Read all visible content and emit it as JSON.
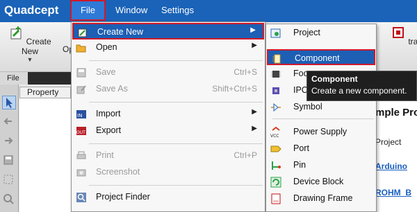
{
  "app": {
    "name": "Quadcept"
  },
  "menubar": {
    "file": "File",
    "window": "Window",
    "settings": "Settings"
  },
  "ribbon": {
    "create_new": "Create New",
    "open_partial": "Op",
    "extra_partial": "tra Librari",
    "tab_file": "File"
  },
  "panel": {
    "property_header": "Property"
  },
  "background": {
    "title_partial": "mple Pro",
    "project_label": "Project",
    "link1": "Arduino",
    "link2": "ROHM_B"
  },
  "file_menu": {
    "create_new": "Create New",
    "open": "Open",
    "save": "Save",
    "save_shortcut": "Ctrl+S",
    "save_as": "Save As",
    "save_as_shortcut": "Shift+Ctrl+S",
    "import": "Import",
    "export": "Export",
    "print": "Print",
    "print_shortcut": "Ctrl+P",
    "screenshot": "Screenshot",
    "project_finder": "Project Finder"
  },
  "create_new_menu": {
    "project": "Project",
    "component": "Component",
    "footprint_partial": "Foo",
    "ipc_partial": "IPC",
    "symbol": "Symbol",
    "power_supply": "Power Supply",
    "port": "Port",
    "pin": "Pin",
    "device_block": "Device Block",
    "drawing_frame": "Drawing Frame"
  },
  "tooltip": {
    "title": "Component",
    "description": "Create a new component."
  },
  "icons": {
    "submenu_arrow": "▶"
  },
  "colors": {
    "menubar": "#1a63b8",
    "highlight": "#1c5fb4",
    "highlight_border": "#d0182a",
    "link": "#1a5fc0"
  }
}
